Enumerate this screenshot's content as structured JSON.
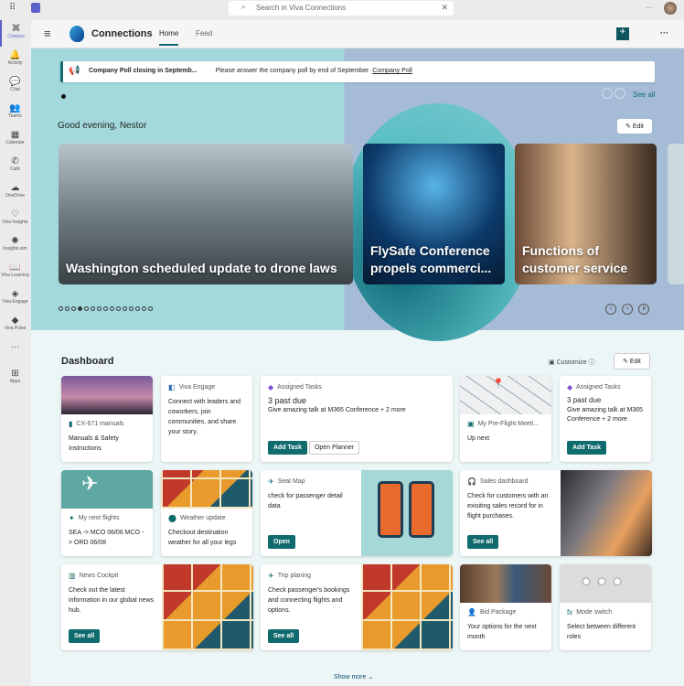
{
  "topbar": {
    "search_placeholder": "Search in Viva Connections",
    "more": "···"
  },
  "rail": [
    {
      "label": "Contoso",
      "icon": "⌘"
    },
    {
      "label": "Activity",
      "icon": "🔔"
    },
    {
      "label": "Chat",
      "icon": "💬"
    },
    {
      "label": "Teams",
      "icon": "👥"
    },
    {
      "label": "Calendar",
      "icon": "▦"
    },
    {
      "label": "Calls",
      "icon": "✆"
    },
    {
      "label": "OneDrive",
      "icon": "☁"
    },
    {
      "label": "Viva Insights",
      "icon": "♡"
    },
    {
      "label": "Insights sim",
      "icon": "✺"
    },
    {
      "label": "Viva Learning",
      "icon": "📖"
    },
    {
      "label": "Viva Engage",
      "icon": "◈"
    },
    {
      "label": "Viva Pulse",
      "icon": "◆"
    },
    {
      "label": "",
      "icon": "···"
    },
    {
      "label": "Apps",
      "icon": "⊞"
    }
  ],
  "header": {
    "title": "Connections",
    "tabs": [
      "Home",
      "Feed"
    ],
    "more": "···"
  },
  "banner": {
    "title": "Company Poll closing in Septemb...",
    "message": "Please answer the company poll by end of September",
    "link": "Company Poll"
  },
  "hero": {
    "see_all": "See all",
    "greeting": "Good evening, Nestor",
    "edit": "Edit",
    "news": [
      "Washington scheduled update to drone laws",
      "FlySafe Conference propels commerci...",
      "Functions of customer service"
    ]
  },
  "dashboard": {
    "title": "Dashboard",
    "customize": "Customize",
    "edit": "Edit",
    "show_more": "Show more",
    "cards": {
      "manuals": {
        "label": "CX-671 manuals",
        "text": "Manuals & Safety Instructions"
      },
      "engage": {
        "label": "Viva Engage",
        "text": "Connect with leaders and coworkers, join communities, and share your story."
      },
      "tasks": {
        "label": "Assigned Tasks",
        "heading": "3 past due",
        "text": "Give amazing talk at M365 Conference + 2 more",
        "btn1": "Add Task",
        "btn2": "Open Planner"
      },
      "meeting": {
        "label": "My Pre-Flight Meeti...",
        "text": "Up next"
      },
      "tasks2": {
        "label": "Assigned Tasks",
        "heading": "3 past due",
        "text": "Give amazing talk at M365 Conference + 2 more",
        "btn1": "Add Task"
      },
      "flights": {
        "label": "My next flights",
        "text": "SEA -> MCO 06/06 MCO -> ORD 06/08"
      },
      "weather": {
        "label": "Weather update",
        "text": "Checkout destination weather for all your legs"
      },
      "seat": {
        "label": "Seat Map",
        "text": "check for passenger detail data",
        "btn": "Open"
      },
      "sales": {
        "label": "Sales dashboard",
        "text": "Check for customers with an exisiting sales record for in flight purchases.",
        "btn": "See all"
      },
      "newsc": {
        "label": "News Cockpit",
        "text": "Check out the latest information in our global news hub.",
        "btn": "See all"
      },
      "trip": {
        "label": "Trip planing",
        "text": "Check passenger's bookings and connecting flights and options.",
        "btn": "See all"
      },
      "bid": {
        "label": "Bid Package",
        "text": "Your options for the next month"
      },
      "mode": {
        "label": "Mode switch",
        "text": "Select between different roles"
      }
    }
  },
  "colors": {
    "accent": "#0f6b6e",
    "teams": "#5b5fc7"
  }
}
